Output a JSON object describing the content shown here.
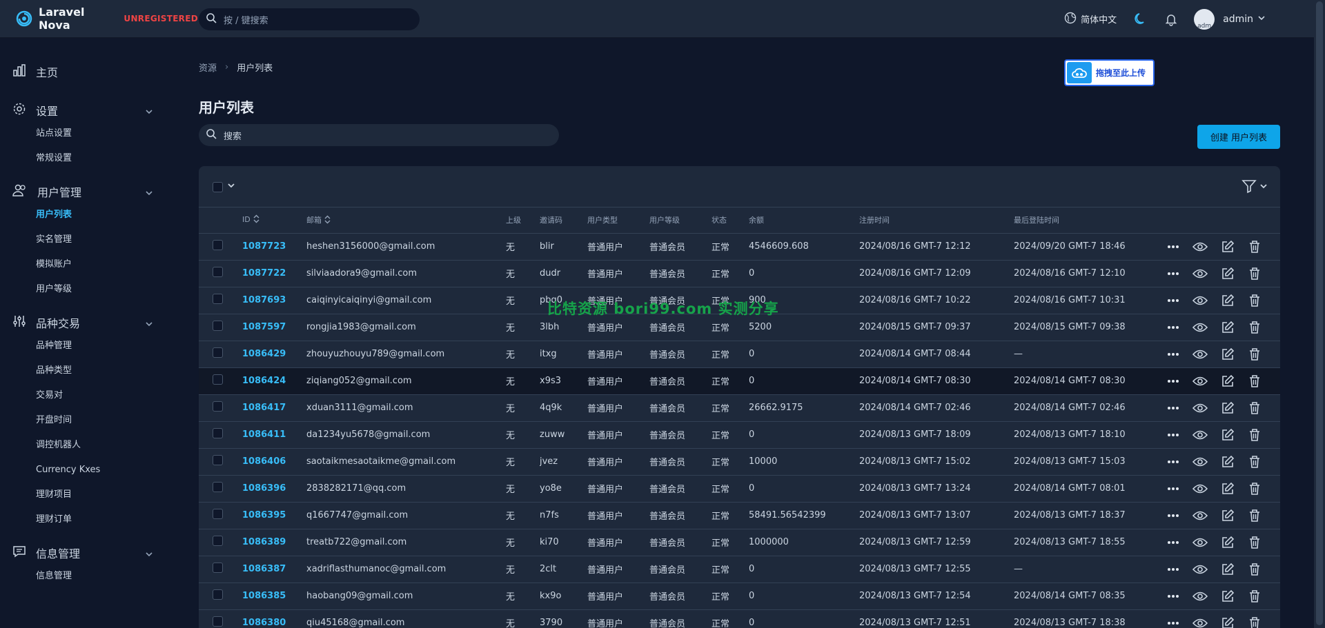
{
  "brand": {
    "name": "Laravel Nova",
    "tag": "UNREGISTERED"
  },
  "topbar": {
    "search_placeholder": "按 / 键搜索",
    "language": "简体中文",
    "user": "admin",
    "avatar_alt": "adm"
  },
  "sidebar": {
    "home": "主页",
    "settings": {
      "label": "设置",
      "items": [
        "站点设置",
        "常规设置"
      ]
    },
    "users": {
      "label": "用户管理",
      "items": [
        "用户列表",
        "实名管理",
        "模拟账户",
        "用户等级"
      ]
    },
    "trading": {
      "label": "品种交易",
      "items": [
        "品种管理",
        "品种类型",
        "交易对",
        "开盘时间",
        "调控机器人",
        "Currency Kxes",
        "理财项目",
        "理财订单"
      ]
    },
    "info": {
      "label": "信息管理",
      "items": [
        "信息管理"
      ]
    }
  },
  "breadcrumb": {
    "root": "资源",
    "current": "用户列表"
  },
  "upload_button": "拖拽至此上传",
  "page_title": "用户列表",
  "main_search_placeholder": "搜索",
  "create_button": "创建 用户列表",
  "watermark": "比特资源  bori99.com  实测分享",
  "table": {
    "columns": [
      "ID",
      "邮箱",
      "上级",
      "邀请码",
      "用户类型",
      "用户等级",
      "状态",
      "余额",
      "注册时间",
      "最后登陆时间"
    ],
    "rows": [
      [
        "1087723",
        "heshen3156000@gmail.com",
        "无",
        "blir",
        "普通用户",
        "普通会员",
        "正常",
        "4546609.608",
        "2024/08/16 GMT-7 12:12",
        "2024/09/20 GMT-7 18:46"
      ],
      [
        "1087722",
        "silviaadora9@gmail.com",
        "无",
        "dudr",
        "普通用户",
        "普通会员",
        "正常",
        "0",
        "2024/08/16 GMT-7 12:09",
        "2024/08/16 GMT-7 12:10"
      ],
      [
        "1087693",
        "caiqinyicaiqinyi@gmail.com",
        "无",
        "pbq0",
        "普通用户",
        "普通会员",
        "正常",
        "900",
        "2024/08/16 GMT-7 10:22",
        "2024/08/16 GMT-7 10:31"
      ],
      [
        "1087597",
        "rongjia1983@gmail.com",
        "无",
        "3lbh",
        "普通用户",
        "普通会员",
        "正常",
        "5200",
        "2024/08/15 GMT-7 09:37",
        "2024/08/15 GMT-7 09:38"
      ],
      [
        "1086429",
        "zhouyuzhouyu789@gmail.com",
        "无",
        "itxg",
        "普通用户",
        "普通会员",
        "正常",
        "0",
        "2024/08/14 GMT-7 08:44",
        "—"
      ],
      [
        "1086424",
        "ziqiang052@gmail.com",
        "无",
        "x9s3",
        "普通用户",
        "普通会员",
        "正常",
        "0",
        "2024/08/14 GMT-7 08:30",
        "2024/08/14 GMT-7 08:30"
      ],
      [
        "1086417",
        "xduan3111@gmail.com",
        "无",
        "4q9k",
        "普通用户",
        "普通会员",
        "正常",
        "26662.9175",
        "2024/08/14 GMT-7 02:46",
        "2024/08/14 GMT-7 02:46"
      ],
      [
        "1086411",
        "da1234yu5678@gmail.com",
        "无",
        "zuww",
        "普通用户",
        "普通会员",
        "正常",
        "0",
        "2024/08/13 GMT-7 18:09",
        "2024/08/13 GMT-7 18:10"
      ],
      [
        "1086406",
        "saotaikmesaotaikme@gmail.com",
        "无",
        "jvez",
        "普通用户",
        "普通会员",
        "正常",
        "10000",
        "2024/08/13 GMT-7 15:02",
        "2024/08/13 GMT-7 15:03"
      ],
      [
        "1086396",
        "2838282171@qq.com",
        "无",
        "yo8e",
        "普通用户",
        "普通会员",
        "正常",
        "0",
        "2024/08/13 GMT-7 13:24",
        "2024/08/14 GMT-7 08:01"
      ],
      [
        "1086395",
        "q1667747@gmail.com",
        "无",
        "n7fs",
        "普通用户",
        "普通会员",
        "正常",
        "58491.56542399",
        "2024/08/13 GMT-7 13:07",
        "2024/08/13 GMT-7 18:37"
      ],
      [
        "1086389",
        "treatb722@gmail.com",
        "无",
        "ki70",
        "普通用户",
        "普通会员",
        "正常",
        "1000000",
        "2024/08/13 GMT-7 12:59",
        "2024/08/13 GMT-7 18:55"
      ],
      [
        "1086387",
        "xadriflasthumanoc@gmail.com",
        "无",
        "2clt",
        "普通用户",
        "普通会员",
        "正常",
        "0",
        "2024/08/13 GMT-7 12:55",
        "—"
      ],
      [
        "1086385",
        "haobang09@gmail.com",
        "无",
        "kx9o",
        "普通用户",
        "普通会员",
        "正常",
        "0",
        "2024/08/13 GMT-7 12:54",
        "2024/08/14 GMT-7 08:35"
      ],
      [
        "1086380",
        "qiu45168@gmail.com",
        "无",
        "3790",
        "普通用户",
        "普通会员",
        "正常",
        "0",
        "2024/08/13 GMT-7 12:51",
        "2024/08/13 GMT-7 18:38"
      ]
    ],
    "highlighted_row": 5
  },
  "colors": {
    "accent": "#38bdf8",
    "button": "#0ea5e9",
    "danger": "#ef4444",
    "background": "#0f172a",
    "panel": "#1e293b"
  },
  "icons": {
    "row_actions": [
      "more-icon",
      "view-icon",
      "edit-icon",
      "delete-icon"
    ]
  }
}
